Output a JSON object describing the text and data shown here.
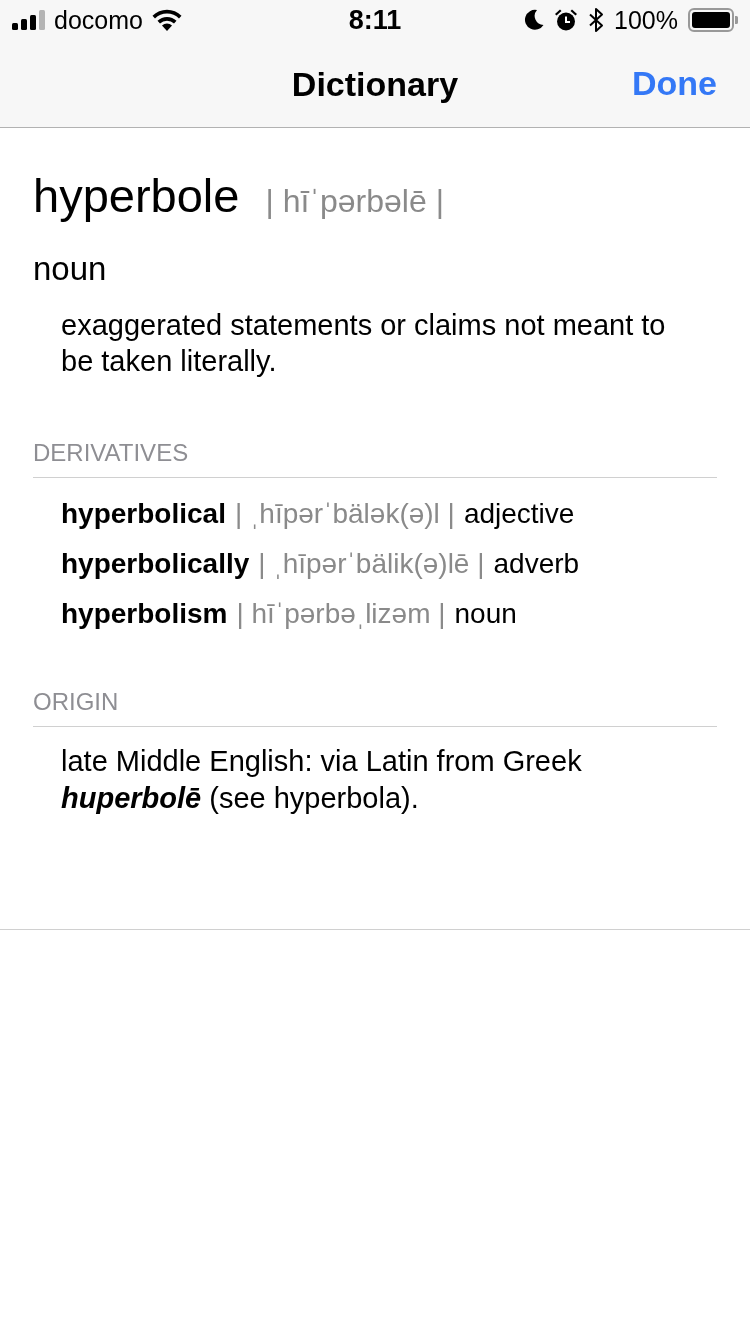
{
  "status_bar": {
    "carrier": "docomo",
    "time": "8:11",
    "battery": "100%"
  },
  "nav_bar": {
    "title": "Dictionary",
    "done_button": "Done"
  },
  "entry": {
    "headword": "hyperbole",
    "pronunciation": "| hīˈpərbəlē |",
    "part_of_speech": "noun",
    "definition": "exaggerated statements or claims not meant to be taken literally."
  },
  "sections": [
    {
      "kind": "derivatives",
      "heading": "DERIVATIVES",
      "items": [
        {
          "word": "hyperbolical",
          "pronunciation": "| ˌhīpərˈbälək(ə)l |",
          "part_of_speech": "adjective"
        },
        {
          "word": "hyperbolically",
          "pronunciation": "| ˌhīpərˈbälik(ə)lē |",
          "part_of_speech": "adverb"
        },
        {
          "word": "hyperbolism",
          "pronunciation": "| hīˈpərbəˌlizəm |",
          "part_of_speech": "noun"
        }
      ]
    },
    {
      "kind": "text",
      "heading": "ORIGIN",
      "text": "late Middle English: via Latin from Greek *huperbolē* (see hyperbola)."
    }
  ]
}
